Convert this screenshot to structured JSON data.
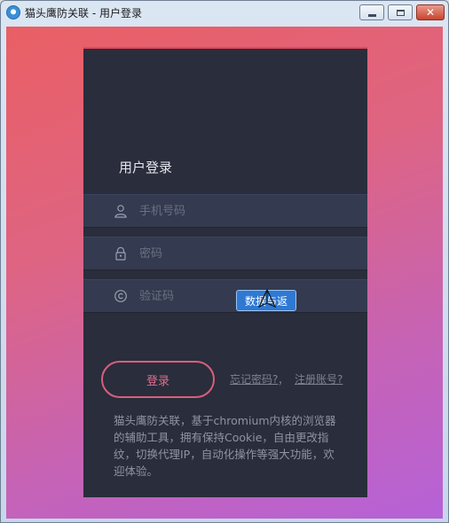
{
  "window": {
    "title": "猫头鹰防关联 - 用户登录"
  },
  "panel": {
    "title": "用户登录",
    "phone_placeholder": "手机号码",
    "password_placeholder": "密码",
    "captcha_placeholder": "验证码",
    "captcha_badge": "数据与返",
    "login_label": "登录",
    "forgot_label": "忘记密码?",
    "separator": "，",
    "register_label": "注册账号?",
    "description": "猫头鹰防关联，基于chromium内核的浏览器的辅助工具，拥有保持Cookie，自由更改指纹，切换代理IP，自动化操作等强大功能，欢迎体验。"
  },
  "colors": {
    "accent": "#e0475a",
    "panel_bg": "#2a2d3b",
    "badge_bg": "#2f79d3"
  },
  "icons": {
    "phone": "user-icon",
    "password": "lock-icon",
    "captcha": "copyright-icon"
  }
}
